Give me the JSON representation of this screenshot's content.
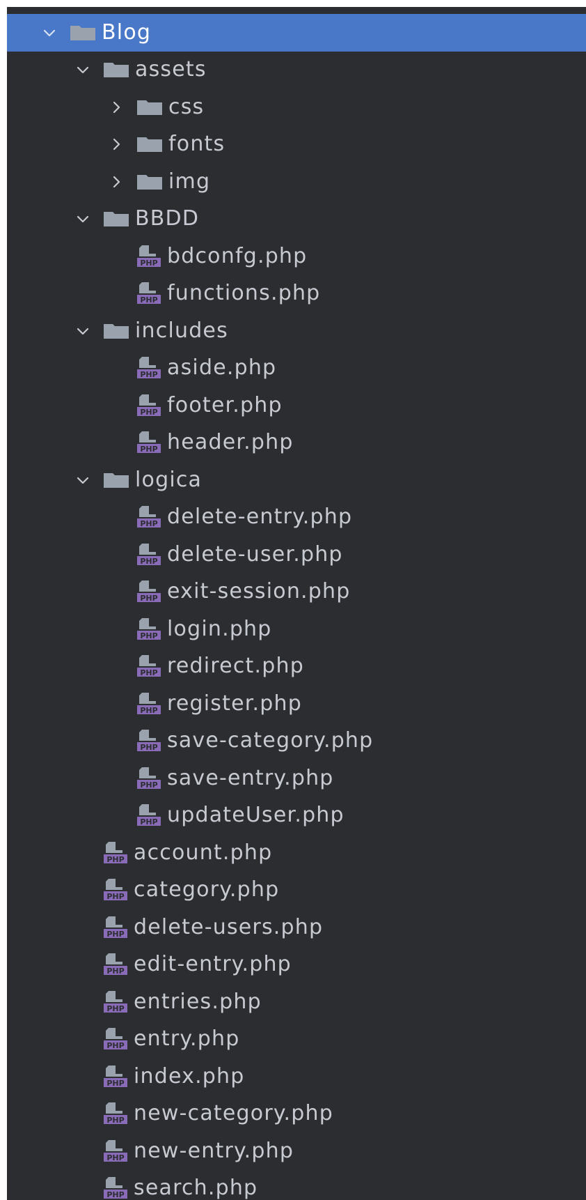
{
  "project_tree": {
    "root": {
      "label": "Blog",
      "expanded": true,
      "selected": true
    },
    "folders": {
      "assets": {
        "label": "assets",
        "expanded": true
      },
      "css": {
        "label": "css",
        "expanded": false
      },
      "fonts": {
        "label": "fonts",
        "expanded": false
      },
      "img": {
        "label": "img",
        "expanded": false
      },
      "bbdd": {
        "label": "BBDD",
        "expanded": true
      },
      "includes": {
        "label": "includes",
        "expanded": true
      },
      "logica": {
        "label": "logica",
        "expanded": true
      }
    },
    "files": {
      "bbdd": [
        "bdconfg.php",
        "functions.php"
      ],
      "includes": [
        "aside.php",
        "footer.php",
        "header.php"
      ],
      "logica": [
        "delete-entry.php",
        "delete-user.php",
        "exit-session.php",
        "login.php",
        "redirect.php",
        "register.php",
        "save-category.php",
        "save-entry.php",
        "updateUser.php"
      ],
      "root": [
        "account.php",
        "category.php",
        "delete-users.php",
        "edit-entry.php",
        "entries.php",
        "entry.php",
        "index.php",
        "new-category.php",
        "new-entry.php",
        "search.php"
      ]
    }
  },
  "colors": {
    "panel_background": "#2b2d30",
    "selection": "#4a78c8",
    "text": "#c7cbd1",
    "folder": "#9aa3ad",
    "php_icon": "#8a6bb8"
  },
  "icons": {
    "folder": "folder-icon",
    "php_file": "php-file-icon",
    "expanded": "chevron-down-icon",
    "collapsed": "chevron-right-icon"
  }
}
